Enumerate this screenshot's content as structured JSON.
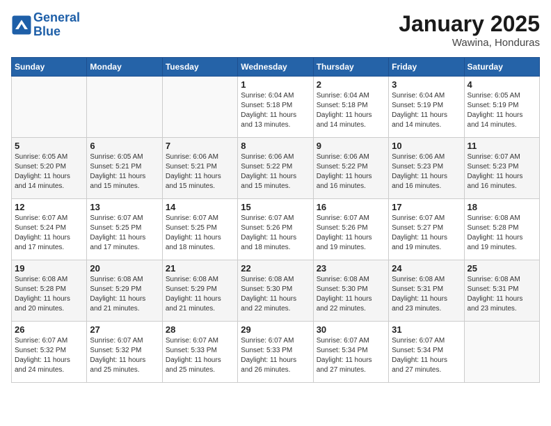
{
  "logo": {
    "line1": "General",
    "line2": "Blue"
  },
  "title": "January 2025",
  "subtitle": "Wawina, Honduras",
  "days_of_week": [
    "Sunday",
    "Monday",
    "Tuesday",
    "Wednesday",
    "Thursday",
    "Friday",
    "Saturday"
  ],
  "weeks": [
    [
      {
        "day": "",
        "info": ""
      },
      {
        "day": "",
        "info": ""
      },
      {
        "day": "",
        "info": ""
      },
      {
        "day": "1",
        "info": "Sunrise: 6:04 AM\nSunset: 5:18 PM\nDaylight: 11 hours\nand 13 minutes."
      },
      {
        "day": "2",
        "info": "Sunrise: 6:04 AM\nSunset: 5:18 PM\nDaylight: 11 hours\nand 14 minutes."
      },
      {
        "day": "3",
        "info": "Sunrise: 6:04 AM\nSunset: 5:19 PM\nDaylight: 11 hours\nand 14 minutes."
      },
      {
        "day": "4",
        "info": "Sunrise: 6:05 AM\nSunset: 5:19 PM\nDaylight: 11 hours\nand 14 minutes."
      }
    ],
    [
      {
        "day": "5",
        "info": "Sunrise: 6:05 AM\nSunset: 5:20 PM\nDaylight: 11 hours\nand 14 minutes."
      },
      {
        "day": "6",
        "info": "Sunrise: 6:05 AM\nSunset: 5:21 PM\nDaylight: 11 hours\nand 15 minutes."
      },
      {
        "day": "7",
        "info": "Sunrise: 6:06 AM\nSunset: 5:21 PM\nDaylight: 11 hours\nand 15 minutes."
      },
      {
        "day": "8",
        "info": "Sunrise: 6:06 AM\nSunset: 5:22 PM\nDaylight: 11 hours\nand 15 minutes."
      },
      {
        "day": "9",
        "info": "Sunrise: 6:06 AM\nSunset: 5:22 PM\nDaylight: 11 hours\nand 16 minutes."
      },
      {
        "day": "10",
        "info": "Sunrise: 6:06 AM\nSunset: 5:23 PM\nDaylight: 11 hours\nand 16 minutes."
      },
      {
        "day": "11",
        "info": "Sunrise: 6:07 AM\nSunset: 5:23 PM\nDaylight: 11 hours\nand 16 minutes."
      }
    ],
    [
      {
        "day": "12",
        "info": "Sunrise: 6:07 AM\nSunset: 5:24 PM\nDaylight: 11 hours\nand 17 minutes."
      },
      {
        "day": "13",
        "info": "Sunrise: 6:07 AM\nSunset: 5:25 PM\nDaylight: 11 hours\nand 17 minutes."
      },
      {
        "day": "14",
        "info": "Sunrise: 6:07 AM\nSunset: 5:25 PM\nDaylight: 11 hours\nand 18 minutes."
      },
      {
        "day": "15",
        "info": "Sunrise: 6:07 AM\nSunset: 5:26 PM\nDaylight: 11 hours\nand 18 minutes."
      },
      {
        "day": "16",
        "info": "Sunrise: 6:07 AM\nSunset: 5:26 PM\nDaylight: 11 hours\nand 19 minutes."
      },
      {
        "day": "17",
        "info": "Sunrise: 6:07 AM\nSunset: 5:27 PM\nDaylight: 11 hours\nand 19 minutes."
      },
      {
        "day": "18",
        "info": "Sunrise: 6:08 AM\nSunset: 5:28 PM\nDaylight: 11 hours\nand 19 minutes."
      }
    ],
    [
      {
        "day": "19",
        "info": "Sunrise: 6:08 AM\nSunset: 5:28 PM\nDaylight: 11 hours\nand 20 minutes."
      },
      {
        "day": "20",
        "info": "Sunrise: 6:08 AM\nSunset: 5:29 PM\nDaylight: 11 hours\nand 21 minutes."
      },
      {
        "day": "21",
        "info": "Sunrise: 6:08 AM\nSunset: 5:29 PM\nDaylight: 11 hours\nand 21 minutes."
      },
      {
        "day": "22",
        "info": "Sunrise: 6:08 AM\nSunset: 5:30 PM\nDaylight: 11 hours\nand 22 minutes."
      },
      {
        "day": "23",
        "info": "Sunrise: 6:08 AM\nSunset: 5:30 PM\nDaylight: 11 hours\nand 22 minutes."
      },
      {
        "day": "24",
        "info": "Sunrise: 6:08 AM\nSunset: 5:31 PM\nDaylight: 11 hours\nand 23 minutes."
      },
      {
        "day": "25",
        "info": "Sunrise: 6:08 AM\nSunset: 5:31 PM\nDaylight: 11 hours\nand 23 minutes."
      }
    ],
    [
      {
        "day": "26",
        "info": "Sunrise: 6:07 AM\nSunset: 5:32 PM\nDaylight: 11 hours\nand 24 minutes."
      },
      {
        "day": "27",
        "info": "Sunrise: 6:07 AM\nSunset: 5:32 PM\nDaylight: 11 hours\nand 25 minutes."
      },
      {
        "day": "28",
        "info": "Sunrise: 6:07 AM\nSunset: 5:33 PM\nDaylight: 11 hours\nand 25 minutes."
      },
      {
        "day": "29",
        "info": "Sunrise: 6:07 AM\nSunset: 5:33 PM\nDaylight: 11 hours\nand 26 minutes."
      },
      {
        "day": "30",
        "info": "Sunrise: 6:07 AM\nSunset: 5:34 PM\nDaylight: 11 hours\nand 27 minutes."
      },
      {
        "day": "31",
        "info": "Sunrise: 6:07 AM\nSunset: 5:34 PM\nDaylight: 11 hours\nand 27 minutes."
      },
      {
        "day": "",
        "info": ""
      }
    ]
  ]
}
